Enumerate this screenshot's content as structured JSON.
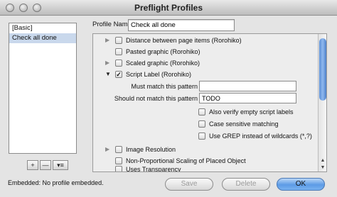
{
  "window": {
    "title": "Preflight Profiles"
  },
  "profiles": [
    "[Basic]",
    "Check all done"
  ],
  "list_tools": [
    "+",
    "—",
    "▾≡"
  ],
  "profile_name": {
    "label": "Profile Name:",
    "value": "Check all done"
  },
  "rules": {
    "distance": "Distance between page items (Rorohiko)",
    "pasted": "Pasted graphic (Rorohiko)",
    "scaled": "Scaled graphic (Rorohiko)",
    "script_label": "Script Label (Rorohiko)",
    "image_resolution": "Image Resolution",
    "non_proportional": "Non-Proportional Scaling of Placed Object",
    "transparency": "Uses Transparency"
  },
  "script_label_options": {
    "must_match_label": "Must match this pattern",
    "must_match_value": "",
    "should_not_match_label": "Should not match this pattern",
    "should_not_match_value": "TODO",
    "verify_empty": "Also verify empty script labels",
    "case_sensitive": "Case sensitive matching",
    "use_grep": "Use GREP instead of wildcards (*,?)"
  },
  "embedded": "Embedded:  No profile embedded.",
  "buttons": {
    "save": "Save",
    "delete": "Delete",
    "ok": "OK"
  }
}
